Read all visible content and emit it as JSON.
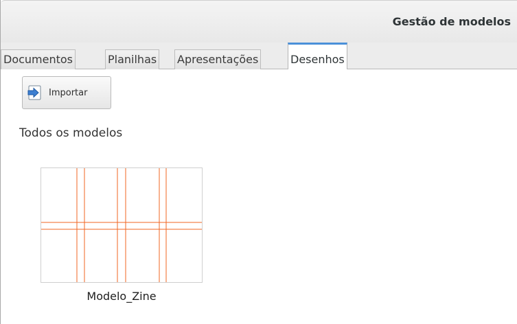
{
  "window": {
    "title": "Gestão de modelos"
  },
  "tabs": [
    {
      "label": "Documentos",
      "active": false
    },
    {
      "label": "Planilhas",
      "active": false
    },
    {
      "label": "Apresentações",
      "active": false
    },
    {
      "label": "Desenhos",
      "active": true
    }
  ],
  "toolbar": {
    "import_label": "Importar",
    "import_icon": "import-arrow-icon"
  },
  "main": {
    "section_label": "Todos os modelos",
    "templates": [
      {
        "name": "Modelo_Zine",
        "thumbnail_icon": "zine-grid-thumbnail"
      }
    ]
  },
  "colors": {
    "accent": "#4a90d9",
    "guide_lines": "#f26522"
  }
}
